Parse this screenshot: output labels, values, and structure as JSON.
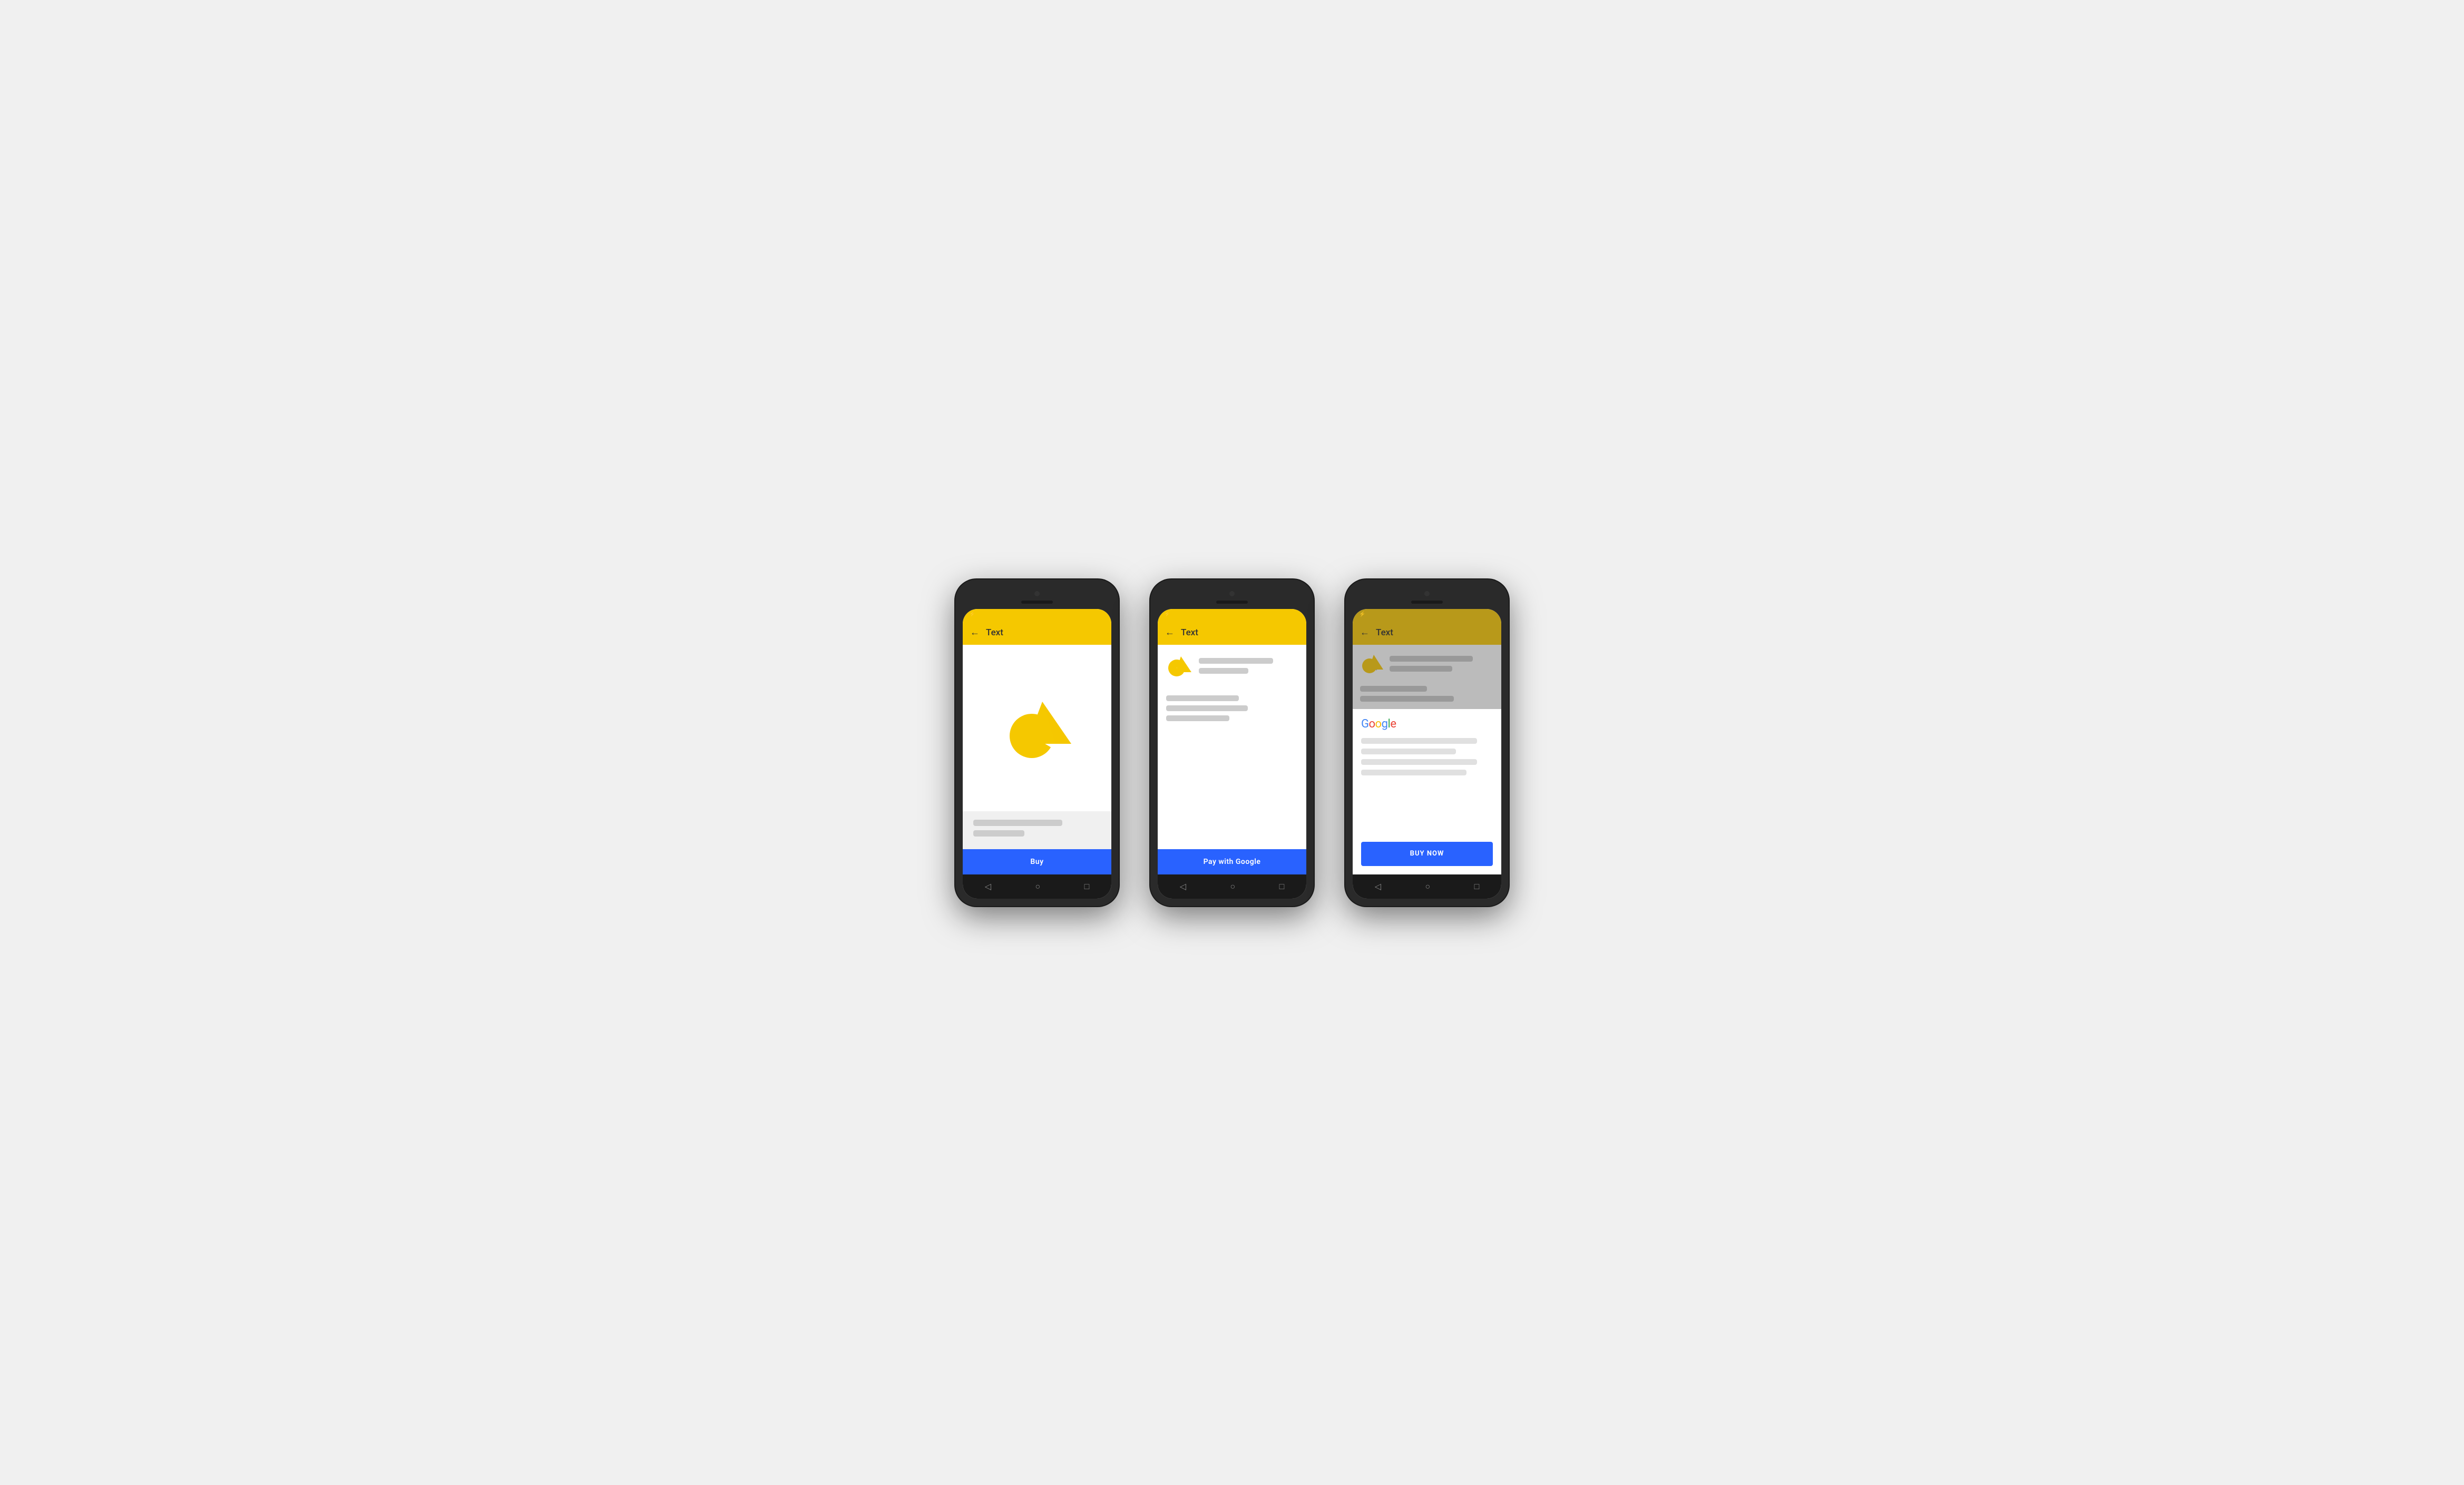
{
  "phones": [
    {
      "id": "phone1",
      "statusBar": {
        "icon": "⚡"
      },
      "appBar": {
        "title": "Text",
        "backArrow": "←"
      },
      "buyButton": {
        "label": "Buy"
      },
      "textLines": [
        {
          "width": "70%"
        },
        {
          "width": "40%"
        }
      ]
    },
    {
      "id": "phone2",
      "statusBar": {
        "icon": "⚡"
      },
      "appBar": {
        "title": "Text",
        "backArrow": "←"
      },
      "payButton": {
        "label": "Pay with Google"
      },
      "productTextLines": [
        {
          "width": "75%"
        },
        {
          "width": "50%"
        }
      ],
      "descLines": [
        {
          "width": "55%"
        },
        {
          "width": "62%"
        },
        {
          "width": "48%"
        }
      ]
    },
    {
      "id": "phone3",
      "statusBar": {
        "icon": "⚡"
      },
      "appBar": {
        "title": "Text",
        "backArrow": "←"
      },
      "googleLogoText": "Google",
      "buyNowButton": {
        "label": "BUY NOW"
      },
      "dimmedTextLines": [
        {
          "width": "80%"
        },
        {
          "width": "60%"
        }
      ],
      "dimmedDescLines": [
        {
          "width": "50%"
        },
        {
          "width": "70%"
        }
      ],
      "sheetLines": [
        {
          "width": "88%"
        },
        {
          "width": "72%"
        },
        {
          "width": "88%"
        },
        {
          "width": "80%"
        }
      ]
    }
  ],
  "navBar": {
    "backIcon": "◁",
    "homeIcon": "○",
    "recentIcon": "□"
  }
}
